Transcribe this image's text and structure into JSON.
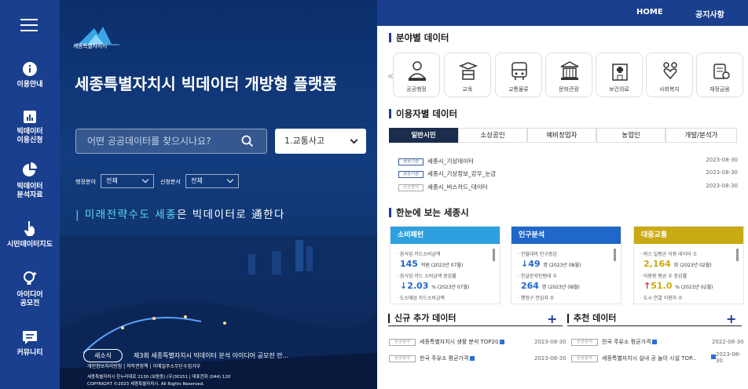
{
  "sidebar": {
    "items": [
      {
        "label": "이용안내"
      },
      {
        "label": "빅데이터\n이용신청"
      },
      {
        "label": "빅데이터\n분석자료"
      },
      {
        "label": "시민데이터지도"
      },
      {
        "label": "아이디어\n공모전"
      },
      {
        "label": "커뮤니티"
      }
    ]
  },
  "hero": {
    "logo_text": "세종특별자치시",
    "title": "세종특별자치시 빅데이터 개방형 플랫폼",
    "search_placeholder": "어떤 공공데이터를 찾으시나요?",
    "select_value": "1.교통사고",
    "filter1_label": "행정분야",
    "filter1_value": "전체",
    "filter2_label": "신청분서",
    "filter2_value": "전체",
    "slogan_a": "미래전략수도 세종",
    "slogan_b": "은 빅데이터로 通한다",
    "news_tag": "새소식",
    "news_text": "제3회 세종특별자치시 빅데이터 분석 아이디어 공모전 안...",
    "footer_links": "개인정보처리방침 | 저작권정책 | 이메일주소무단수집거부",
    "footer_address": "세종특별자치시 한누리대로 2130 (보람동) (우)30151 | 대표전화 (044) 120",
    "footer_copyright": "COPYRIGHT ©2023 세종특별자치시. All Rights Reserved."
  },
  "topnav": {
    "home": "HOME",
    "notice": "공지사항"
  },
  "sections": {
    "field": "분야별 데이터",
    "user": "이용자별 데이터",
    "glance": "한눈에 보는 세종시"
  },
  "categories": [
    {
      "label": "공공행정"
    },
    {
      "label": "교육"
    },
    {
      "label": "교통물류"
    },
    {
      "label": "문화관광"
    },
    {
      "label": "보건의료"
    },
    {
      "label": "사회복지"
    },
    {
      "label": "재정금융"
    }
  ],
  "user_tabs": [
    {
      "label": "일반시민"
    },
    {
      "label": "소상공인"
    },
    {
      "label": "예비창업자"
    },
    {
      "label": "농업인"
    },
    {
      "label": "개발/분석가"
    }
  ],
  "user_list": [
    {
      "badge": "공공기관",
      "title": "세종시_기상데이터",
      "date": "2023-08-30"
    },
    {
      "badge": "공공기관",
      "title": "세종시_기상정보_강우_눈금",
      "date": "2023-08-30"
    },
    {
      "badge": "공공분야",
      "title": "세종시_버스카드_데이터",
      "date": "2023-08-30"
    }
  ],
  "cards": [
    {
      "header": "소비패턴",
      "color": "#2ea0e0",
      "item1_label": "· 음식업 카드소비금액",
      "item1_value": "145",
      "item1_unit": "억원 (2023년 07월)",
      "item2_label": "· 음식업 카드 소비금액 증감률",
      "item2_value": "2.03",
      "item2_unit": "% (2023년 07월)",
      "item3_label": "· 도소매업 카드소비금액"
    },
    {
      "header": "인구분석",
      "color": "#1f67c8",
      "item1_label": "· 전월대비 인구증감",
      "item1_value": "49",
      "item1_unit": "명 (2023년 08월)",
      "item2_label": "· 한글문자인텐데 수",
      "item2_value": "264",
      "item2_unit": "명 (2023년 08월)",
      "item3_label": "· 행정구 전입자 수"
    },
    {
      "header": "대중교통",
      "color": "#c9aa12",
      "item1_label": "· 버스 일평균 이용 데이터 소",
      "item1_value": "2,164",
      "item1_unit": "회 (2023년 02월)",
      "item2_label": "· 이용량 평균 수 증감률",
      "item2_value": "51.0",
      "item2_unit": "% (2023년 02월)",
      "item3_label": "· 도시 연결 이용자 수"
    }
  ],
  "new_data": {
    "title": "신규 추가 데이터",
    "plus": "+",
    "items": [
      {
        "badge": "공공분야",
        "title": "세종특별자치시 생활 분석 TOP20",
        "date": "2023-08-30"
      },
      {
        "badge": "공공분야",
        "title": "한국 주유소 평균가격",
        "date": "2023-08-30"
      }
    ]
  },
  "recommend": {
    "title": "추천 데이터",
    "plus": "+",
    "items": [
      {
        "badge": "공공분야",
        "title": "전국 주유소 평균가격",
        "date": "2022-08-30"
      },
      {
        "badge": "공공분야",
        "title": "세종특별자치시 실내 공 놀이 시설 TOP...",
        "date": "2023-08-30"
      }
    ]
  },
  "colors": {
    "brand": "#1a3f8e",
    "accent": "#5fd8f0"
  }
}
